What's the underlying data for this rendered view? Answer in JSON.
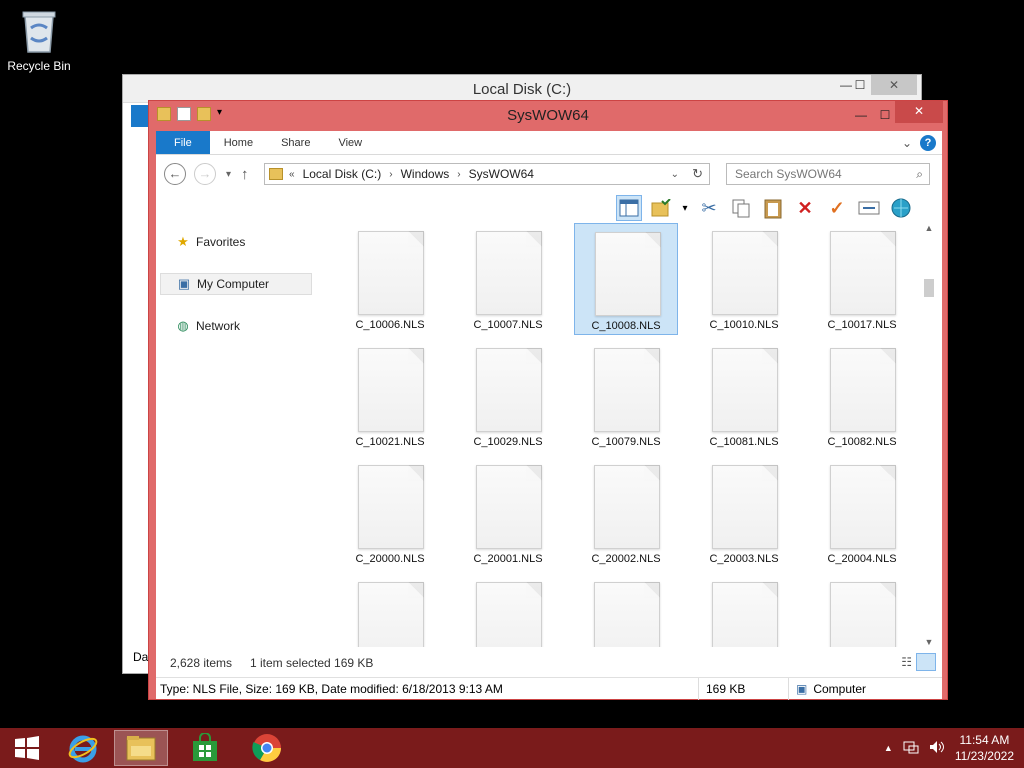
{
  "desktop": {
    "recycle_bin_label": "Recycle Bin"
  },
  "back_window": {
    "title": "Local Disk (C:)",
    "min": "—",
    "max": "☐",
    "close": "✕",
    "left_stub_text": "Dat"
  },
  "window": {
    "title": "SysWOW64",
    "min": "—",
    "max": "☐",
    "close": "✕",
    "accent": "#e06a6a",
    "ribbon": {
      "tabs": [
        "File",
        "Home",
        "Share",
        "View"
      ],
      "collapse": "⌄",
      "help": "?"
    },
    "nav": {
      "back": "←",
      "forward": "→",
      "recent": "▾",
      "up": "↑",
      "crumb_prefix": "«",
      "crumbs": [
        "Local Disk (C:)",
        "Windows",
        "SysWOW64"
      ],
      "crumb_sep": "›",
      "dropdown": "⌄",
      "refresh": "↻",
      "search_placeholder": "Search SysWOW64",
      "search_icon": "⌕"
    },
    "toolbar_icons": [
      "preview-pane-icon",
      "folder-options-icon",
      "dropdown-icon",
      "cut-icon",
      "copy-icon",
      "paste-icon",
      "delete-icon",
      "check-icon",
      "rename-icon",
      "internet-icon"
    ],
    "navigation_pane": {
      "items": [
        {
          "label": "Favorites",
          "icon": "star-icon"
        },
        {
          "label": "My Computer",
          "icon": "computer-icon",
          "selected": true
        },
        {
          "label": "Network",
          "icon": "network-icon"
        }
      ]
    },
    "files": [
      {
        "name": "C_10006.NLS"
      },
      {
        "name": "C_10007.NLS"
      },
      {
        "name": "C_10008.NLS",
        "selected": true
      },
      {
        "name": "C_10010.NLS"
      },
      {
        "name": "C_10017.NLS"
      },
      {
        "name": "C_10021.NLS"
      },
      {
        "name": "C_10029.NLS"
      },
      {
        "name": "C_10079.NLS"
      },
      {
        "name": "C_10081.NLS"
      },
      {
        "name": "C_10082.NLS"
      },
      {
        "name": "C_20000.NLS"
      },
      {
        "name": "C_20001.NLS"
      },
      {
        "name": "C_20002.NLS"
      },
      {
        "name": "C_20003.NLS"
      },
      {
        "name": "C_20004.NLS"
      },
      {
        "name": ""
      },
      {
        "name": ""
      },
      {
        "name": ""
      },
      {
        "name": ""
      },
      {
        "name": ""
      }
    ],
    "status": {
      "items_count": "2,628 items",
      "selection": "1 item selected  169 KB"
    },
    "details_bar": {
      "info": "Type: NLS File, Size: 169 KB, Date modified: 6/18/2013 9:13 AM",
      "size": "169 KB",
      "location": "Computer"
    }
  },
  "taskbar": {
    "color": "#7a1b1b",
    "time": "11:54 AM",
    "date": "11/23/2022",
    "tray_caret": "▲"
  }
}
